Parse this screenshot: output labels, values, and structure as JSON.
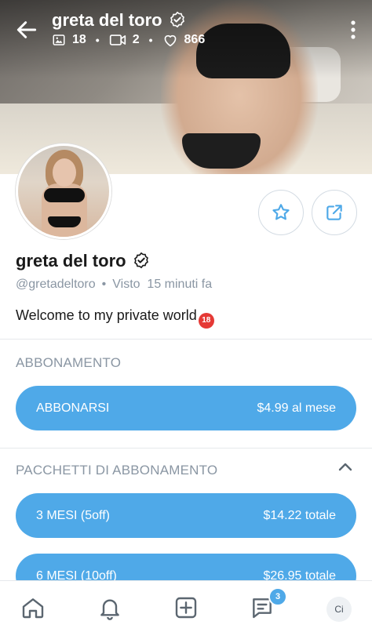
{
  "header": {
    "title": "greta del toro",
    "photos_count": "18",
    "videos_count": "2",
    "likes_count": "866"
  },
  "profile": {
    "name": "greta del toro",
    "handle": "@gretadeltoro",
    "separator": "•",
    "last_seen": "Visto  15 minuti fa",
    "bio": "Welcome to my private world",
    "bio_badge": "18"
  },
  "subscription": {
    "section_title": "ABBONAMENTO",
    "button_label": "ABBONARSI",
    "button_price": "$4.99 al mese"
  },
  "bundles": {
    "section_title": "PACCHETTI DI ABBONAMENTO",
    "items": [
      {
        "label": "3 MESI (5off)",
        "price": "$14.22 totale"
      },
      {
        "label": "6 MESI (10off)",
        "price": "$26.95 totale"
      }
    ]
  },
  "bottom_nav": {
    "messages_badge": "3",
    "avatar_initials": "Ci"
  },
  "colors": {
    "accent": "#4fa9e8",
    "muted_text": "#8a96a3"
  }
}
